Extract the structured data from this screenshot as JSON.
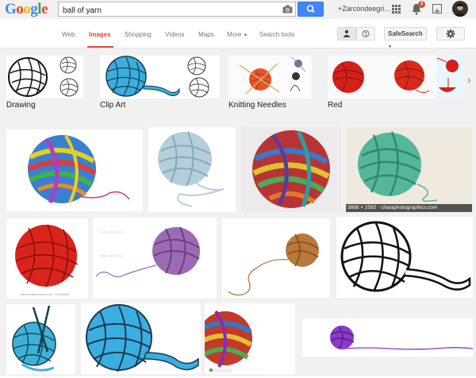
{
  "search": {
    "query": "ball of yarn"
  },
  "header": {
    "user_name": "+Zarcondeegri...",
    "notification_count": "3"
  },
  "tabs": [
    "Web",
    "Images",
    "Shopping",
    "Videos",
    "Maps",
    "More",
    "Search tools"
  ],
  "safesearch_label": "SafeSearch",
  "related": [
    {
      "label": "Drawing"
    },
    {
      "label": "Clip Art"
    },
    {
      "label": "Knitting Needles"
    },
    {
      "label": "Red"
    }
  ],
  "image_meta": "3888 × 2592 · charaphotographics.com",
  "colors": {
    "accent_red": "#dd4b39",
    "search_blue": "#4285f4"
  }
}
